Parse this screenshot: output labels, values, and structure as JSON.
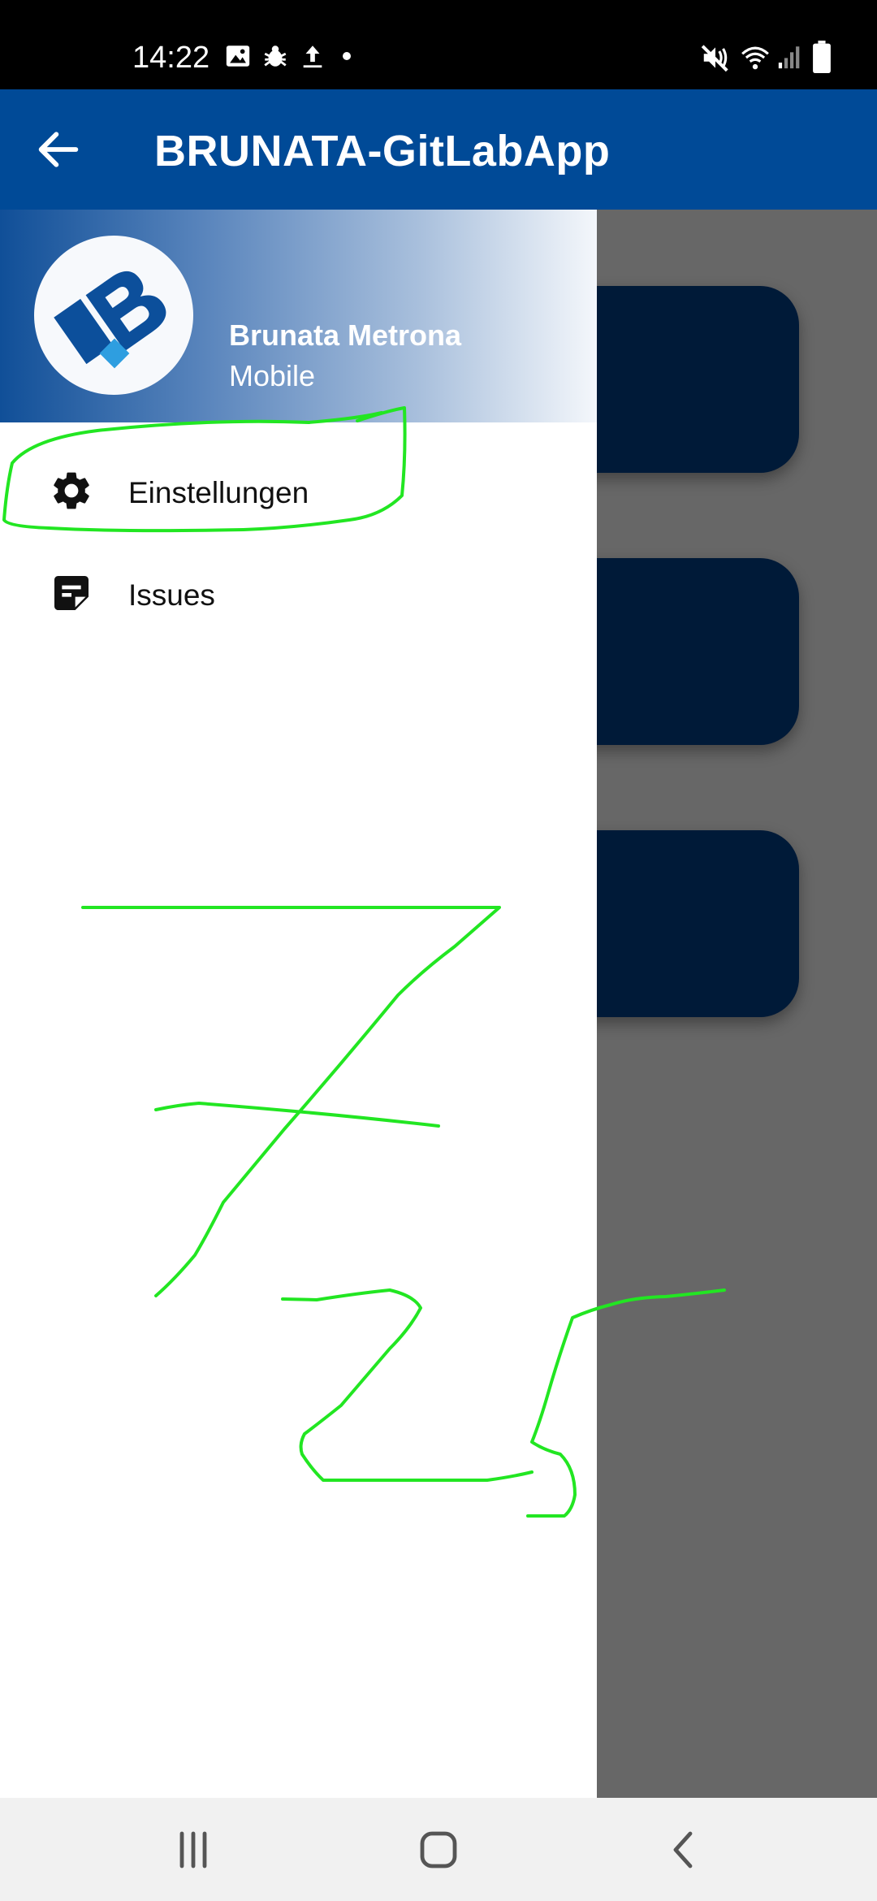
{
  "status_bar": {
    "time": "14:22",
    "left_icons": [
      "image-icon",
      "bug-icon",
      "upload-icon",
      "dot-icon"
    ],
    "right_icons": [
      "mute-icon",
      "wifi-icon",
      "signal-icon",
      "battery-icon"
    ]
  },
  "app_bar": {
    "title": "BRUNATA-GitLabApp",
    "back_icon": "arrow-back-icon",
    "color": "#004a97"
  },
  "drawer": {
    "header": {
      "title": "Brunata Metrona",
      "subtitle": "Mobile",
      "logo": "brunata-logo"
    },
    "items": [
      {
        "label": "Einstellungen",
        "icon": "gear-icon"
      },
      {
        "label": "Issues",
        "icon": "note-icon"
      }
    ]
  },
  "annotation_color": "#22e622",
  "system_nav": {
    "buttons": [
      "recents-icon",
      "home-icon",
      "back-icon"
    ]
  }
}
